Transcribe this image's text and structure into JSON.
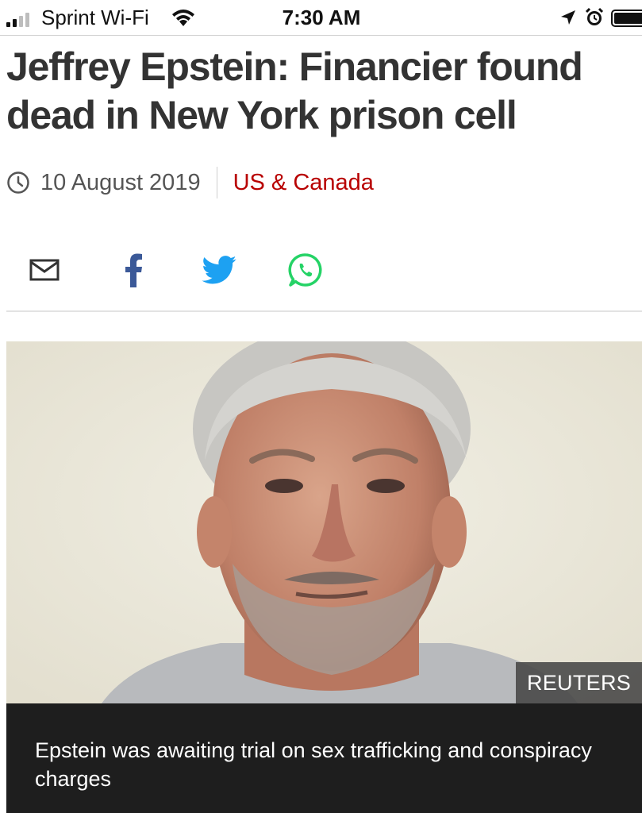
{
  "status_bar": {
    "carrier": "Sprint Wi-Fi",
    "time": "7:30 AM",
    "signal_bars_active": 2,
    "signal_bars_total": 4,
    "battery_level": 1.0
  },
  "article": {
    "headline": "Jeffrey Epstein: Financier found dead in New York prison cell",
    "date": "10 August 2019",
    "section": "US & Canada",
    "section_color": "#b80000"
  },
  "share": {
    "icons": [
      "email-icon",
      "facebook-icon",
      "twitter-icon",
      "whatsapp-icon"
    ],
    "facebook_color": "#3b5998",
    "twitter_color": "#1da1f2",
    "whatsapp_color": "#25d366"
  },
  "image": {
    "credit": "REUTERS",
    "caption": "Epstein was awaiting trial on sex trafficking and conspiracy charges"
  }
}
